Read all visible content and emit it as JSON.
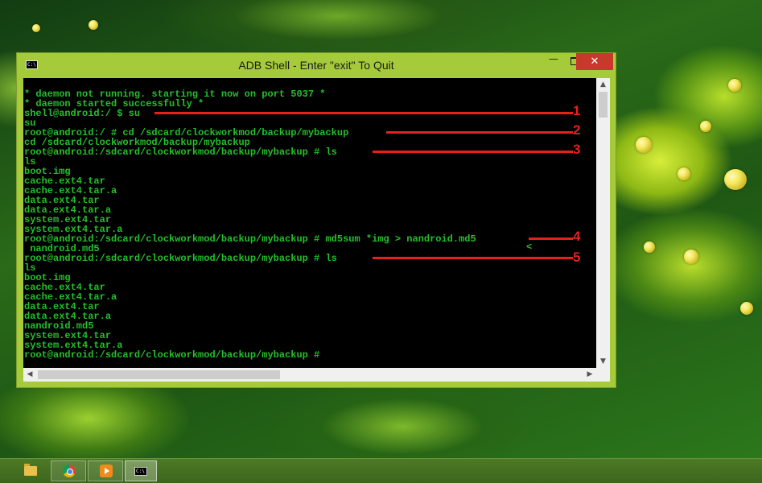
{
  "window": {
    "title": "ADB Shell - Enter \"exit\" To Quit",
    "icon": "cmd-icon",
    "controls": {
      "minimize": "—",
      "maximize": "maximize-icon",
      "close": "✕"
    }
  },
  "console": {
    "lines": [
      "* daemon not running. starting it now on port 5037 *",
      "* daemon started successfully *",
      "shell@android:/ $ su",
      "su",
      "root@android:/ # cd /sdcard/clockworkmod/backup/mybackup",
      "cd /sdcard/clockworkmod/backup/mybackup",
      "root@android:/sdcard/clockworkmod/backup/mybackup # ls",
      "ls",
      "boot.img",
      "cache.ext4.tar",
      "cache.ext4.tar.a",
      "data.ext4.tar",
      "data.ext4.tar.a",
      "system.ext4.tar",
      "system.ext4.tar.a",
      "root@android:/sdcard/clockworkmod/backup/mybackup # md5sum *img > nandroid.md5",
      " nandroid.md5",
      "root@android:/sdcard/clockworkmod/backup/mybackup # ls",
      "ls",
      "boot.img",
      "cache.ext4.tar",
      "cache.ext4.tar.a",
      "data.ext4.tar",
      "data.ext4.tar.a",
      "nandroid.md5",
      "system.ext4.tar",
      "system.ext4.tar.a",
      "root@android:/sdcard/clockworkmod/backup/mybackup #"
    ],
    "stray_char": "<"
  },
  "annotations": {
    "color": "#e8201c",
    "labels": [
      "1",
      "2",
      "3",
      "4",
      "5"
    ]
  },
  "scrollbars": {
    "up_arrow": "▲",
    "down_arrow": "▼",
    "left_arrow": "◀",
    "right_arrow": "▶"
  },
  "taskbar": {
    "items": [
      "file-explorer-icon",
      "chrome-icon",
      "media-player-icon",
      "command-prompt-icon"
    ]
  },
  "colors": {
    "console_text": "#22c02a",
    "window_border": "#a6cb3a",
    "close_button": "#c7392b"
  }
}
